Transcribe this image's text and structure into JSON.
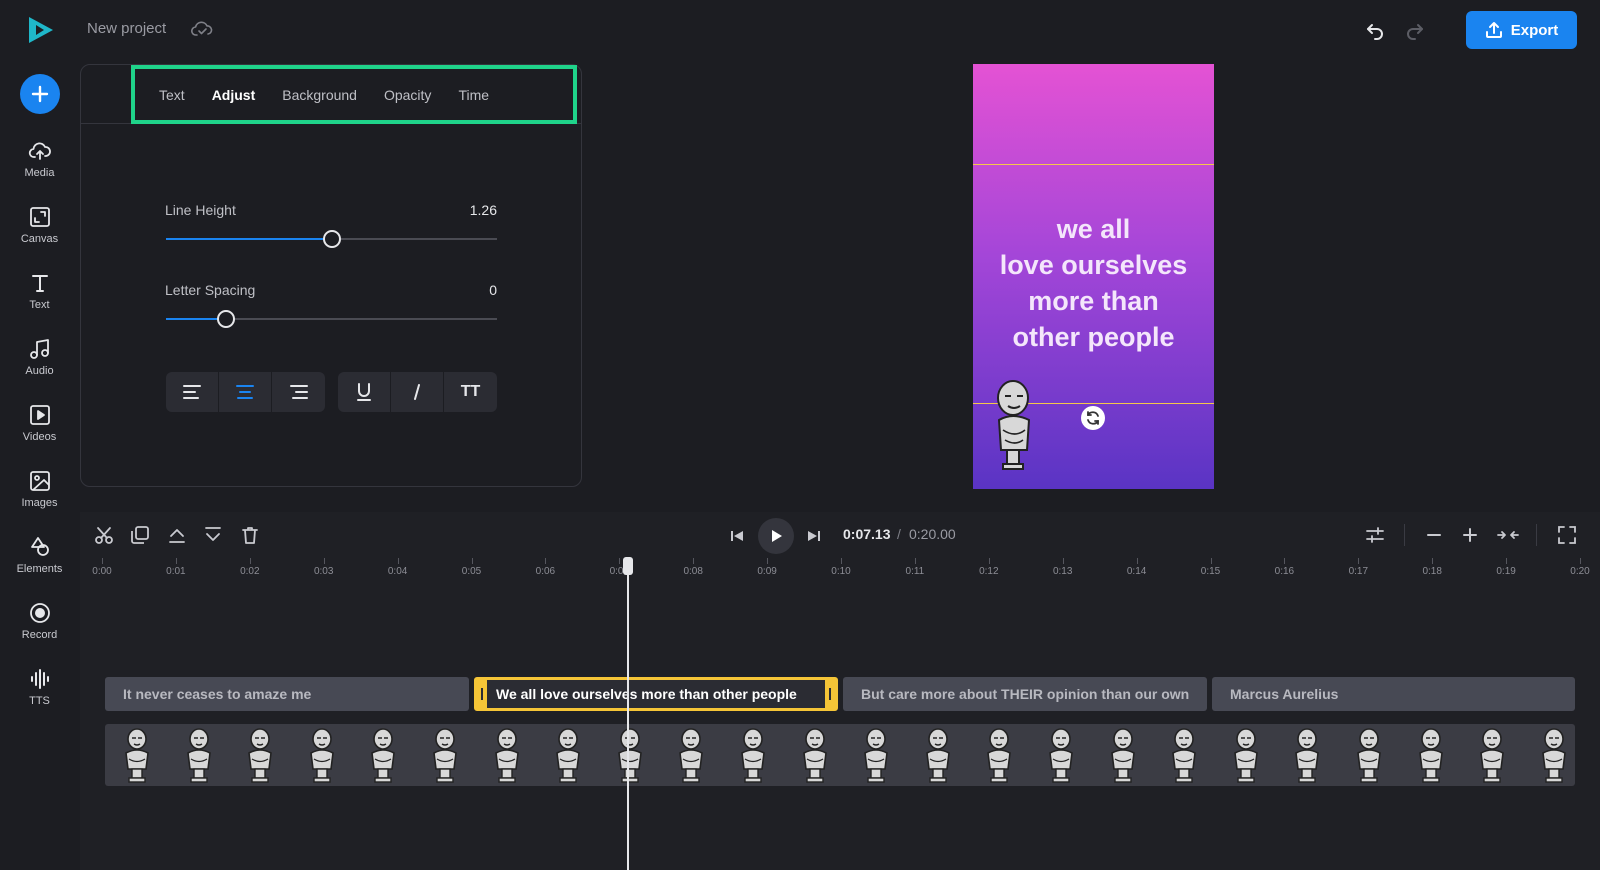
{
  "app": {
    "project_title": "New project",
    "export_label": "Export",
    "accent_color": "#1a84f0"
  },
  "sidebar": {
    "items": [
      {
        "label": "Media",
        "icon": "cloud-upload-icon"
      },
      {
        "label": "Canvas",
        "icon": "canvas-icon"
      },
      {
        "label": "Text",
        "icon": "text-icon"
      },
      {
        "label": "Audio",
        "icon": "music-note-icon"
      },
      {
        "label": "Videos",
        "icon": "video-icon"
      },
      {
        "label": "Images",
        "icon": "image-icon"
      },
      {
        "label": "Elements",
        "icon": "shapes-icon"
      },
      {
        "label": "Record",
        "icon": "record-icon"
      },
      {
        "label": "TTS",
        "icon": "waveform-icon"
      }
    ]
  },
  "panel": {
    "tabs": [
      {
        "label": "Text",
        "active": false
      },
      {
        "label": "Adjust",
        "active": true
      },
      {
        "label": "Background",
        "active": false
      },
      {
        "label": "Opacity",
        "active": false
      },
      {
        "label": "Time",
        "active": false
      }
    ],
    "line_height": {
      "label": "Line Height",
      "value": "1.26",
      "fraction": 0.5
    },
    "letter_spacing": {
      "label": "Letter Spacing",
      "value": "0",
      "fraction": 0.18
    },
    "alignment": [
      "align-left-icon",
      "align-center-icon",
      "align-right-icon"
    ],
    "alignment_selected": "align-center-icon",
    "style_buttons": [
      "underline-icon",
      "italic-icon",
      "uppercase-icon"
    ],
    "uppercase_glyph": "TT"
  },
  "preview": {
    "text_lines": [
      "we all",
      "love ourselves",
      "more than",
      "other people"
    ]
  },
  "timeline": {
    "current_time": "0:07.13",
    "separator": "/",
    "total_time": "0:20.00",
    "ruler_labels": [
      "0:00",
      "0:01",
      "0:02",
      "0:03",
      "0:04",
      "0:05",
      "0:06",
      "0:07",
      "0:08",
      "0:09",
      "0:10",
      "0:11",
      "0:12",
      "0:13",
      "0:14",
      "0:15",
      "0:16",
      "0:17",
      "0:18",
      "0:19",
      "0:20"
    ],
    "text_clips": [
      {
        "label": "It never ceases to amaze me",
        "selected": false
      },
      {
        "label": "We all love ourselves more than other people",
        "selected": true
      },
      {
        "label": "But care more about THEIR opinion than our own",
        "selected": false
      },
      {
        "label": "Marcus Aurelius",
        "selected": false
      }
    ],
    "thumbnail_count": 24
  }
}
